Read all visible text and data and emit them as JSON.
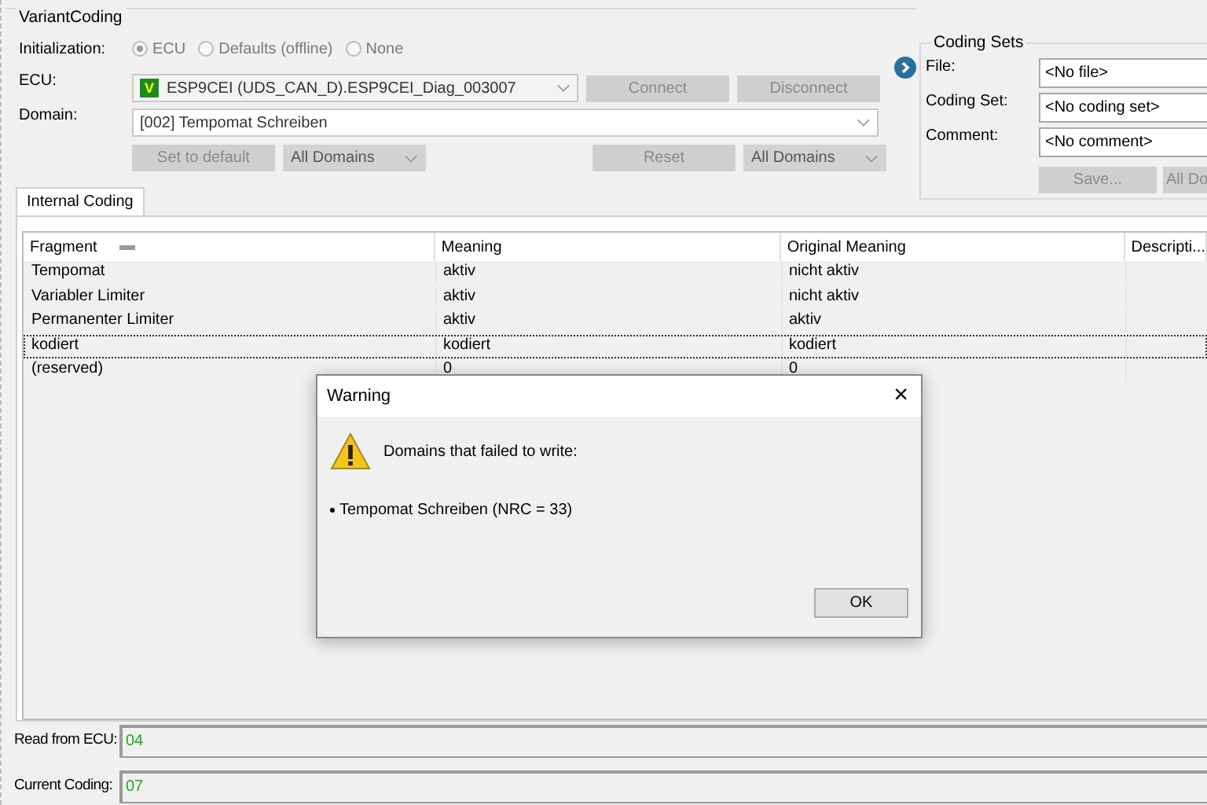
{
  "variant_coding": {
    "title": "VariantCoding",
    "initialization": {
      "label": "Initialization:",
      "options": [
        {
          "label": "ECU",
          "selected": true,
          "disabled": true
        },
        {
          "label": "Defaults (offline)",
          "selected": false,
          "disabled": true
        },
        {
          "label": "None",
          "selected": false,
          "disabled": true
        }
      ]
    },
    "ecu": {
      "label": "ECU:",
      "badge": "V",
      "value": "ESP9CEI (UDS_CAN_D).ESP9CEI_Diag_003007"
    },
    "connect_buttons": [
      {
        "label": "Connect",
        "disabled": true
      },
      {
        "label": "Disconnect",
        "disabled": true
      }
    ],
    "domain": {
      "label": "Domain:",
      "value": "[002] Tempomat Schreiben"
    },
    "left_actions": {
      "button": {
        "label": "Set to default",
        "disabled": true
      },
      "dropdown": "All Domains"
    },
    "right_actions": {
      "button": {
        "label": "Reset",
        "disabled": true
      },
      "dropdown": "All Domains"
    }
  },
  "coding_sets": {
    "title": "Coding Sets",
    "fields": [
      {
        "label": "File:",
        "value": "<No file>"
      },
      {
        "label": "Coding Set:",
        "value": "<No coding set>"
      },
      {
        "label": "Comment:",
        "value": "<No comment>"
      }
    ],
    "buttons": [
      {
        "label": "Save...",
        "disabled": true
      },
      {
        "label": "All Do",
        "disabled": true
      }
    ]
  },
  "tabs": [
    {
      "label": "Internal Coding",
      "selected": true
    }
  ],
  "table": {
    "columns": [
      "Fragment",
      "Meaning",
      "Original Meaning",
      "Descripti..."
    ],
    "rows": [
      {
        "cells": [
          "Tempomat",
          "aktiv",
          "nicht aktiv"
        ],
        "focused": false
      },
      {
        "cells": [
          "Variabler Limiter",
          "aktiv",
          "nicht aktiv"
        ],
        "focused": false
      },
      {
        "cells": [
          "Permanenter Limiter",
          "aktiv",
          "aktiv"
        ],
        "focused": false
      },
      {
        "cells": [
          "kodiert",
          "kodiert",
          "kodiert"
        ],
        "focused": true
      },
      {
        "cells": [
          "(reserved)",
          "0",
          "0"
        ],
        "focused": false
      }
    ]
  },
  "codings": [
    {
      "label": "Read from ECU:",
      "value": "04"
    },
    {
      "label": "Current Coding:",
      "value": "07"
    }
  ],
  "dialog": {
    "title": "Warning",
    "close": "×",
    "message": "Domains that failed to write:",
    "items": [
      "Tempomat Schreiben (NRC = 33)"
    ],
    "button": "OK"
  }
}
